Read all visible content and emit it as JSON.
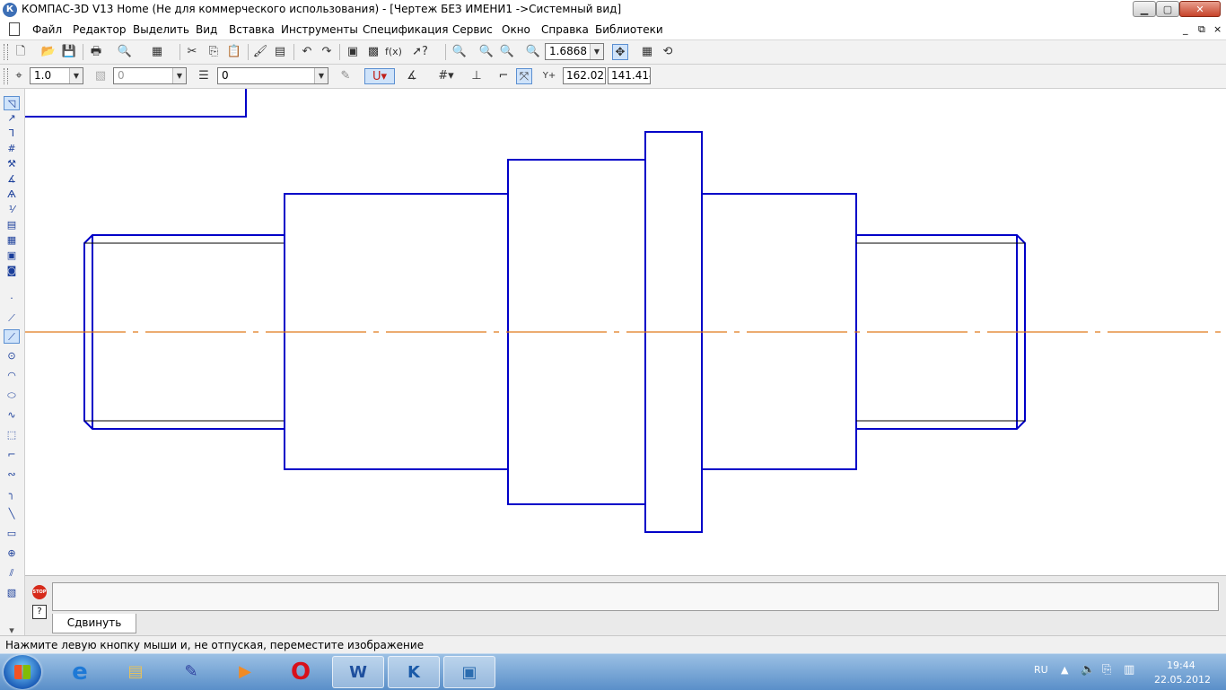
{
  "window": {
    "title": "КОМПАС-3D V13 Home (Не для коммерческого использования) - [Чертеж БЕЗ ИМЕНИ1 ->Системный вид]",
    "app_icon": "К",
    "controls": {
      "min": "▁",
      "max": "▢",
      "close": "✕"
    }
  },
  "menu": {
    "items": [
      "Файл",
      "Редактор",
      "Выделить",
      "Вид",
      "Вставка",
      "Инструменты",
      "Спецификация",
      "Сервис",
      "Окно",
      "Справка",
      "Библиотеки"
    ],
    "mdi_controls": [
      "_",
      "⧉",
      "×"
    ]
  },
  "toolbar1": {
    "zoom_value": "1.6868"
  },
  "toolbar2": {
    "line_scale": "1.0",
    "layer_state": "0",
    "layer": "0",
    "x_coord": "162.027",
    "y_coord": "141.414"
  },
  "drawing": {
    "outline_color": "#0000c8",
    "axis_color": "#e07a1a"
  },
  "command_panel": {
    "stop_label": "STOP",
    "help_label": "?",
    "tab_label": "Сдвинуть"
  },
  "status": {
    "message": "Нажмите левую кнопку мыши и, не отпуская, переместите изображение"
  },
  "taskbar": {
    "apps": [
      {
        "name": "internet-explorer",
        "glyph": "e"
      },
      {
        "name": "file-explorer",
        "glyph": "▤"
      },
      {
        "name": "tools-app",
        "glyph": "✎"
      },
      {
        "name": "media-player",
        "glyph": "▶"
      },
      {
        "name": "opera-browser",
        "glyph": "O"
      },
      {
        "name": "ms-word",
        "glyph": "W"
      },
      {
        "name": "kompas-3d",
        "glyph": "K"
      },
      {
        "name": "image-viewer",
        "glyph": "▣"
      }
    ],
    "language": "RU",
    "time": "19:44",
    "date": "22.05.2012"
  }
}
